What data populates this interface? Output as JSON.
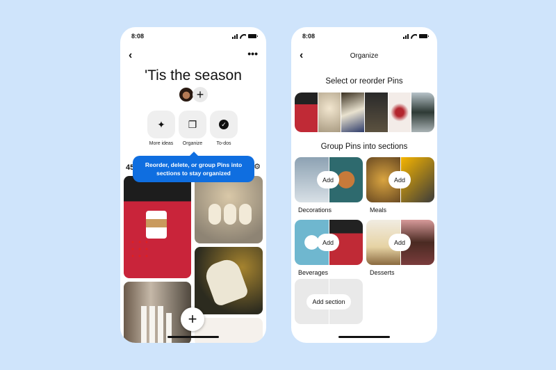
{
  "left_screen": {
    "status": {
      "time": "8:08"
    },
    "board_title": "'Tis the season",
    "add_collaborator": "+",
    "actions": [
      {
        "label": "More ideas",
        "icon": "sparkle"
      },
      {
        "label": "Organize",
        "icon": "organize"
      },
      {
        "label": "To-dos",
        "icon": "check-circle"
      }
    ],
    "pin_count": "45",
    "tooltip": "Reorder, delete, or group  Pins into sections to stay organized",
    "more_icon": "•••",
    "back_icon": "‹",
    "fab_label": "+"
  },
  "right_screen": {
    "status": {
      "time": "8:08"
    },
    "nav_title": "Organize",
    "back_icon": "‹",
    "select_heading": "Select or reorder Pins",
    "group_heading": "Group Pins into sections",
    "sections": [
      {
        "label": "Decorations",
        "button": "Add"
      },
      {
        "label": "Meals",
        "button": "Add"
      },
      {
        "label": "Beverages",
        "button": "Add"
      },
      {
        "label": "Desserts",
        "button": "Add"
      }
    ],
    "add_section": "Add section"
  }
}
